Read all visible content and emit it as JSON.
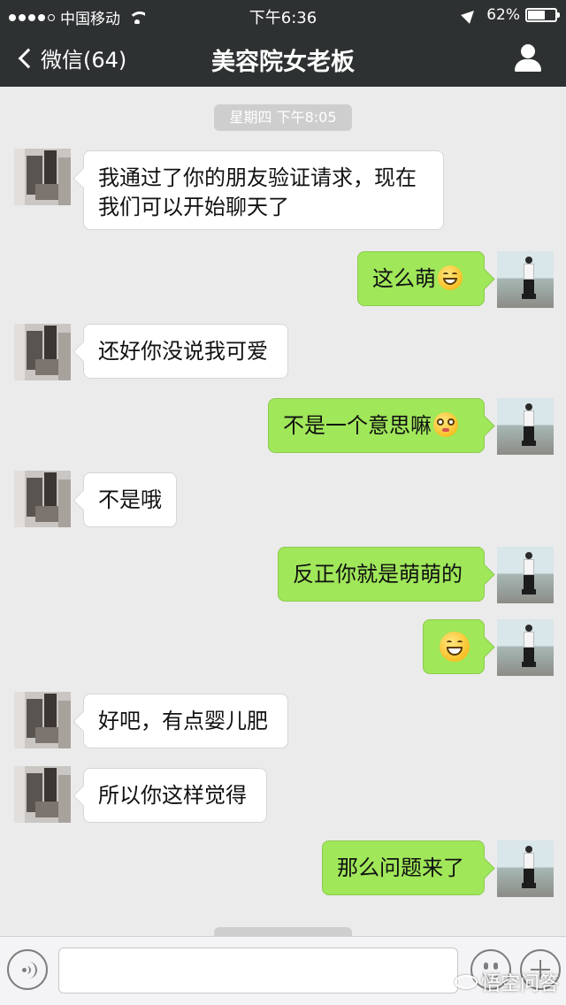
{
  "status_bar": {
    "carrier": "中国移动",
    "time": "下午6:36",
    "battery_text": "62%",
    "battery_level": 0.62
  },
  "nav": {
    "back_label": "微信(64)",
    "title": "美容院女老板"
  },
  "timestamps": [
    "星期四 下午8:05"
  ],
  "messages": [
    {
      "side": "left",
      "text": "我通过了你的朋友验证请求，现在",
      "text2": "我们可以开始聊天了"
    },
    {
      "side": "right",
      "text": "这么萌",
      "emoji": "grin-emoji"
    },
    {
      "side": "left",
      "text": "还好你没说我可爱"
    },
    {
      "side": "right",
      "text": "不是一个意思嘛",
      "emoji": "flushed-emoji"
    },
    {
      "side": "left",
      "text": "不是哦"
    },
    {
      "side": "right",
      "text": "反正你就是萌萌的"
    },
    {
      "side": "right",
      "text": "",
      "emoji": "grin-emoji"
    },
    {
      "side": "left",
      "text": "好吧，有点婴儿肥"
    },
    {
      "side": "left",
      "text": "所以你这样觉得"
    },
    {
      "side": "right",
      "text": "那么问题来了"
    }
  ],
  "input": {
    "value": "",
    "placeholder": ""
  },
  "icons": {
    "voice": "voice-icon",
    "emoji": "emoji-icon",
    "plus": "plus-icon",
    "profile": "profile-icon",
    "back": "chevron-left-icon"
  },
  "colors": {
    "nav_bg": "#2e3132",
    "chat_bg": "#ebebeb",
    "bubble_right": "#a0e75a",
    "bubble_left": "#ffffff"
  },
  "watermark": "悟空问答"
}
